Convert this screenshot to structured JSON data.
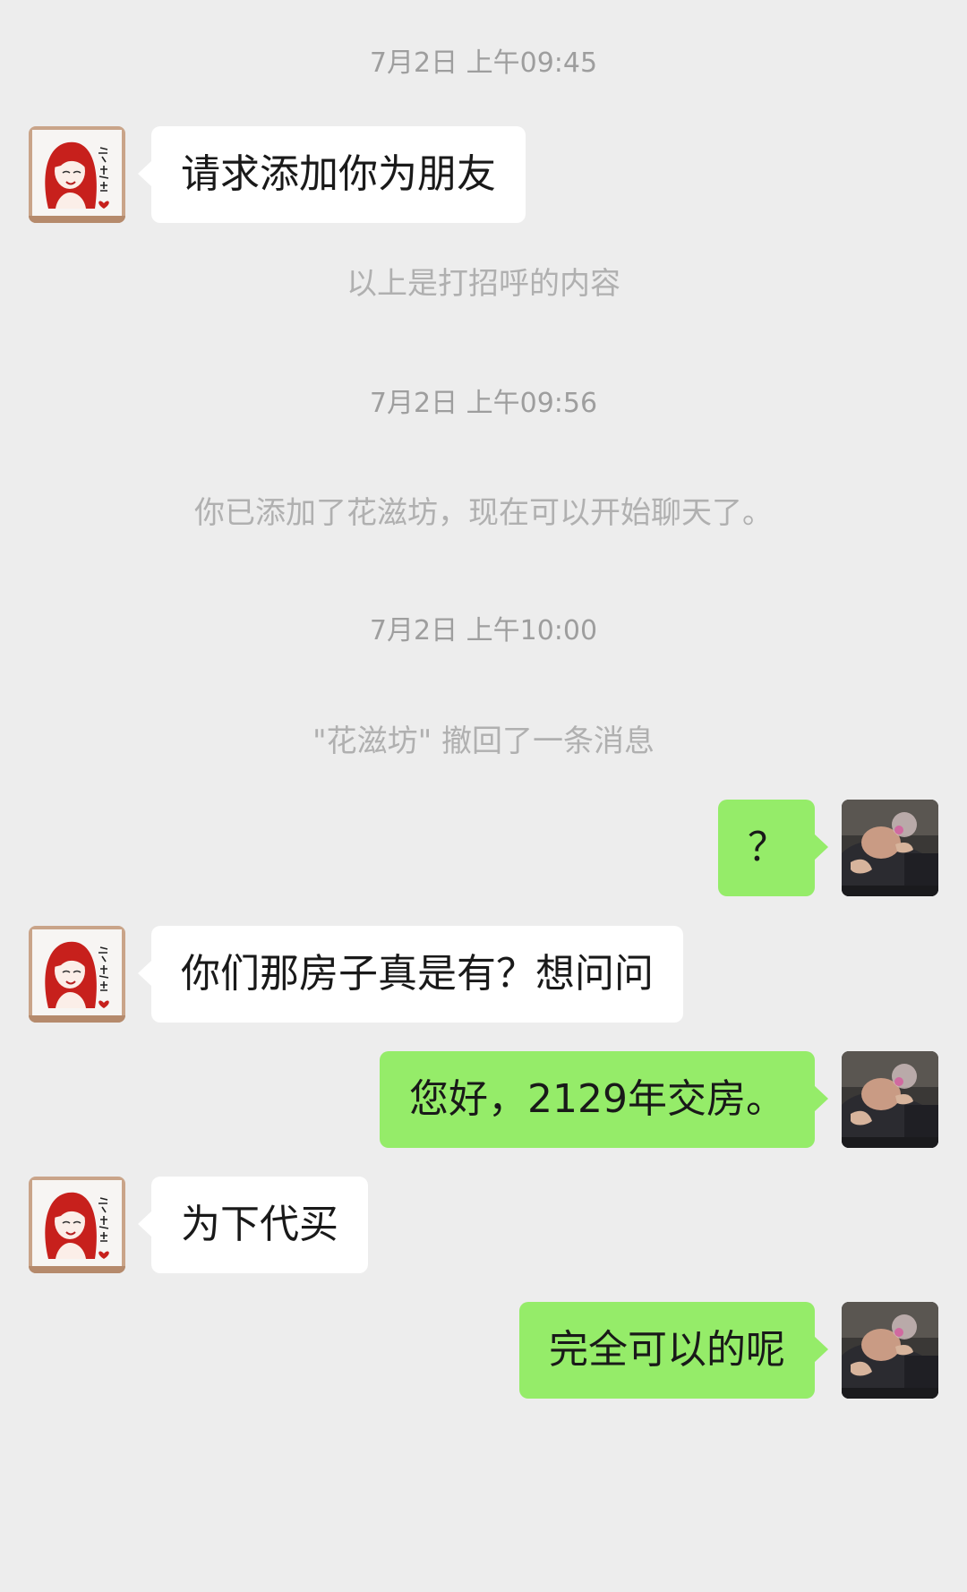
{
  "chat": {
    "timestamps": [
      "7月2日 上午09:45",
      "7月2日 上午09:56",
      "7月2日 上午10:00"
    ],
    "notices": [
      "以上是打招呼的内容",
      "你已添加了花滋坊，现在可以开始聊天了。",
      "\"花滋坊\" 撤回了一条消息"
    ],
    "messages": [
      {
        "side": "incoming",
        "text": "请求添加你为朋友",
        "avatar": "red-hair-girl-avatar"
      },
      {
        "side": "outgoing",
        "text": "？",
        "avatar": "man-photo-avatar"
      },
      {
        "side": "incoming",
        "text": "你们那房子真是有？想问问",
        "avatar": "red-hair-girl-avatar"
      },
      {
        "side": "outgoing",
        "text": "您好，2129年交房。",
        "avatar": "man-photo-avatar"
      },
      {
        "side": "incoming",
        "text": "为下代买",
        "avatar": "red-hair-girl-avatar"
      },
      {
        "side": "outgoing",
        "text": "完全可以的呢",
        "avatar": "man-photo-avatar"
      }
    ],
    "colors": {
      "background": "#ededed",
      "incoming_bubble": "#ffffff",
      "outgoing_bubble": "#95ec69",
      "system_text": "#a9a9a9"
    }
  }
}
